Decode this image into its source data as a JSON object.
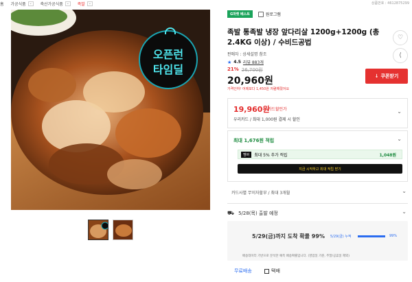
{
  "breadcrumb": {
    "items": [
      "홈",
      "가공식품",
      "축산가공식품",
      "족발"
    ],
    "product_no": "상품번호 : 4612875299"
  },
  "image": {
    "badge_line1": "오픈런",
    "badge_line2": "타임딜"
  },
  "product": {
    "tag": "G마켓 베스트",
    "store": "원로그램",
    "title": "족발 통족발 냉장 앞다리살 1200g+1200g (총 2.4KG 이상) / 수비드공법",
    "seller_line": "판매자 : 상세설명 참조",
    "rating": "4.5",
    "review_text": "리뷰 883개",
    "discount_pct": "21%",
    "original_price": "26,700원",
    "price": "20,960원",
    "price_note": "가격인하! 어제보다 1,450원 저렴해졌어요",
    "coupon_button": "쿠폰받기"
  },
  "card": {
    "price": "19,960원",
    "label": "카드할인가",
    "desc": "우리카드 / 최대 1,000원 결제 시 할인"
  },
  "points": {
    "header": "최대 1,676원 적립",
    "tag": "멤버",
    "row_text": "최대 5% 추가 적립",
    "row_amount": "1,048원",
    "black_bar": "지금 시작하고 최대 적립 받기"
  },
  "install": "카드사별 무이자할부 / 최대 3개월",
  "shipping": {
    "date_row": "5/28(목) 출발 예정",
    "deliv_title": "5/29(금)까지 도착 확률 99%",
    "deliv_sub": "5/29(금) 누적",
    "deliv_pct": "99%",
    "deliv_progress": 0.99,
    "deliv_note": "배송데이터 기반으로 분석한 예측 배송확률입니다. (영업일 기준, 주말/공휴일 제외)",
    "free": "무료배송",
    "parcel": "택배"
  },
  "icons": {
    "heart": "heart-icon",
    "share": "share-icon",
    "chevron": "chevron-down-icon",
    "truck": "truck-icon"
  },
  "colors": {
    "accent_red": "#e53130",
    "point_green": "#1c8a3e",
    "link_blue": "#2a6cf0"
  }
}
